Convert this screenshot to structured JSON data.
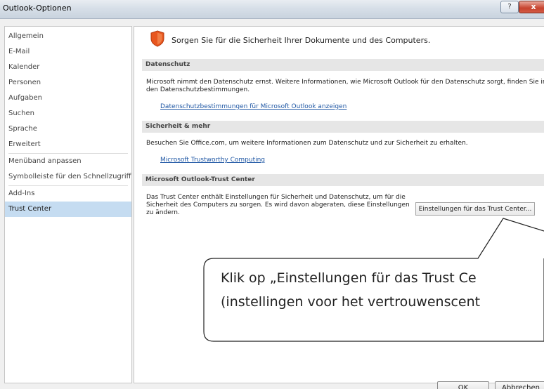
{
  "window": {
    "title": "Outlook-Optionen",
    "help_label": "?",
    "close_label": "x"
  },
  "sidebar": {
    "items": [
      {
        "label": "Allgemein"
      },
      {
        "label": "E-Mail"
      },
      {
        "label": "Kalender"
      },
      {
        "label": "Personen"
      },
      {
        "label": "Aufgaben"
      },
      {
        "label": "Suchen"
      },
      {
        "label": "Sprache"
      },
      {
        "label": "Erweitert"
      },
      {
        "label": "Menüband anpassen"
      },
      {
        "label": "Symbolleiste für den Schnellzugriff"
      },
      {
        "label": "Add-Ins"
      },
      {
        "label": "Trust Center"
      }
    ],
    "active": "Trust Center"
  },
  "main": {
    "header": "Sorgen Sie für die Sicherheit Ihrer Dokumente und des Computers.",
    "sections": [
      {
        "title": "Datenschutz",
        "text": "Microsoft nimmt den Datenschutz ernst. Weitere Informationen, wie Microsoft Outlook für den Datenschutz sorgt, finden Sie in den Datenschutzbestimmungen.",
        "link": "Datenschutzbestimmungen für Microsoft Outlook anzeigen"
      },
      {
        "title": "Sicherheit & mehr",
        "text": "Besuchen Sie Office.com, um weitere Informationen zum Datenschutz und zur Sicherheit zu erhalten.",
        "link": "Microsoft Trustworthy Computing"
      },
      {
        "title": "Microsoft Outlook-Trust Center",
        "text": "Das Trust Center enthält Einstellungen für Sicherheit und Datenschutz, um für die Sicherheit des Computers zu sorgen. Es wird davon abgeraten, diese Einstellungen zu ändern.",
        "button": "Einstellungen für das Trust Center..."
      }
    ]
  },
  "footer": {
    "ok_label": "OK",
    "cancel_label": "Abbrechen"
  },
  "callout": {
    "line1": "Klik op „Einstellungen für das Trust Ce",
    "line2": "(instellingen voor het vertrouwenscent"
  },
  "colors": {
    "active_nav": "#c5dcf1",
    "link": "#1f57a4",
    "shield": "#e8561e",
    "section_header_bg": "#e6e6e6"
  }
}
